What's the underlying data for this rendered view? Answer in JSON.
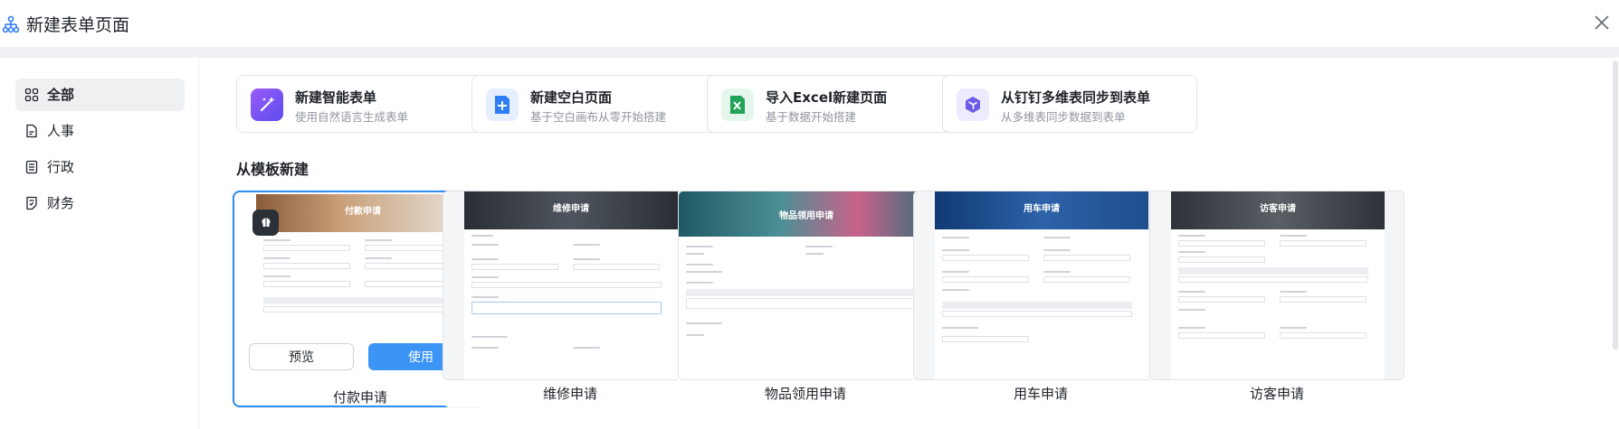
{
  "header": {
    "title": "新建表单页面"
  },
  "sidebar": {
    "items": [
      {
        "label": "全部",
        "icon": "grid-icon",
        "active": true
      },
      {
        "label": "人事",
        "icon": "document-icon"
      },
      {
        "label": "行政",
        "icon": "ledger-icon"
      },
      {
        "label": "财务",
        "icon": "finance-doc-icon"
      }
    ]
  },
  "quick_create": [
    {
      "title": "新建智能表单",
      "subtitle": "使用自然语言生成表单",
      "icon": "magic-wand-icon",
      "color": "#7a4df0"
    },
    {
      "title": "新建空白页面",
      "subtitle": "基于空白画布从零开始搭建",
      "icon": "plus-doc-icon",
      "color": "#2f7df6"
    },
    {
      "title": "导入Excel新建页面",
      "subtitle": "基于数据开始搭建",
      "icon": "excel-icon",
      "color": "#23a25a"
    },
    {
      "title": "从钉钉多维表同步到表单",
      "subtitle": "从多维表同步数据到表单",
      "icon": "cube-sync-icon",
      "color": "#6c5ce7"
    }
  ],
  "templates_section": {
    "title": "从模板新建"
  },
  "templates": [
    {
      "name": "付款申请",
      "banner_title": "付款申请",
      "selected": true,
      "banner_color": "#b08562"
    },
    {
      "name": "维修申请",
      "banner_title": "维修申请",
      "banner_color": "#3a3f47"
    },
    {
      "name": "物品领用申请",
      "banner_title": "物品领用申请",
      "banner_color": "#2f6f7a"
    },
    {
      "name": "用车申请",
      "banner_title": "用车申请",
      "banner_color": "#1f4e8c"
    },
    {
      "name": "访客申请",
      "banner_title": "访客申请",
      "banner_color": "#3d4149"
    }
  ],
  "template_actions": {
    "preview_label": "预览",
    "use_label": "使用"
  }
}
